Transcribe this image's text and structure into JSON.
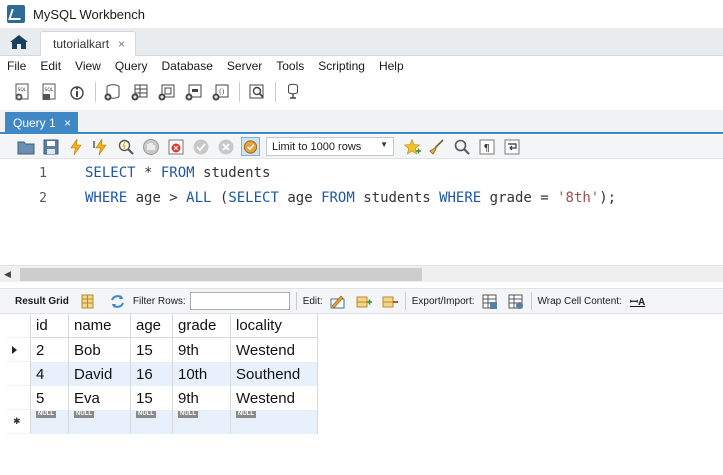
{
  "window": {
    "title": "MySQL Workbench"
  },
  "connection_tab": {
    "label": "tutorialkart",
    "close": "×"
  },
  "menu": [
    "File",
    "Edit",
    "View",
    "Query",
    "Database",
    "Server",
    "Tools",
    "Scripting",
    "Help"
  ],
  "query_tab": {
    "label": "Query 1",
    "close": "×"
  },
  "sql_toolbar": {
    "limit_label": "Limit to 1000 rows"
  },
  "editor": {
    "lines": [
      {
        "number": "1",
        "tokens": [
          [
            "kw",
            "SELECT"
          ],
          [
            "t",
            " * "
          ],
          [
            "kw",
            "FROM"
          ],
          [
            "t",
            " students"
          ]
        ]
      },
      {
        "number": "2",
        "tokens": [
          [
            "kw",
            "WHERE"
          ],
          [
            "t",
            " age > "
          ],
          [
            "kw",
            "ALL"
          ],
          [
            "t",
            " ("
          ],
          [
            "kw",
            "SELECT"
          ],
          [
            "t",
            " age "
          ],
          [
            "kw",
            "FROM"
          ],
          [
            "t",
            " students "
          ],
          [
            "kw",
            "WHERE"
          ],
          [
            "t",
            " grade = "
          ],
          [
            "str",
            "'8th'"
          ],
          [
            "t",
            ");"
          ]
        ]
      }
    ]
  },
  "result_toolbar": {
    "result_grid": "Result Grid",
    "filter_rows": "Filter Rows:",
    "edit": "Edit:",
    "export_import": "Export/Import:",
    "wrap_cell": "Wrap Cell Content:",
    "wrap_icon_text": "ꟷA"
  },
  "grid": {
    "columns": [
      "id",
      "name",
      "age",
      "grade",
      "locality"
    ],
    "rows": [
      [
        "2",
        "Bob",
        "15",
        "9th",
        "Westend"
      ],
      [
        "4",
        "David",
        "16",
        "10th",
        "Southend"
      ],
      [
        "5",
        "Eva",
        "15",
        "9th",
        "Westend"
      ]
    ],
    "null_label": "NULL"
  },
  "colors": {
    "accent": "#3f88c5",
    "keyword": "#1d57a6",
    "string": "#a05050",
    "alt_row": "#e8f1fb"
  }
}
